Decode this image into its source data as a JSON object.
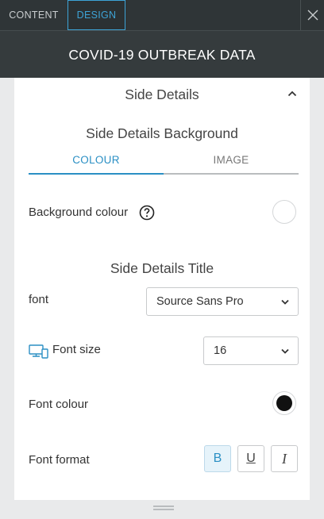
{
  "tabs": [
    {
      "label": "CONTENT",
      "active": false
    },
    {
      "label": "DESIGN",
      "active": true
    }
  ],
  "close_icon": "close-icon",
  "title": "COVID-19 OUTBREAK DATA",
  "section": {
    "header": "Side Details",
    "expanded": true,
    "background": {
      "title": "Side Details Background",
      "tabs": [
        "COLOUR",
        "IMAGE"
      ],
      "active_tab": "COLOUR",
      "background_colour_label": "Background colour",
      "background_colour_value": "#ffffff"
    },
    "title_settings": {
      "title": "Side Details Title",
      "font_label": "font",
      "font_value": "Source Sans Pro",
      "font_size_label": "Font size",
      "font_size_value": "16",
      "font_colour_label": "Font colour",
      "font_colour_value": "#111111",
      "font_format_label": "Font format",
      "format_buttons": [
        {
          "label": "B",
          "name": "bold",
          "active": true
        },
        {
          "label": "U",
          "name": "underline",
          "active": false
        },
        {
          "label": "I",
          "name": "italic",
          "active": false
        }
      ]
    }
  },
  "colors": {
    "accent": "#2a8fc4",
    "topbar": "#2f3537",
    "titlebar": "#353b3d"
  }
}
